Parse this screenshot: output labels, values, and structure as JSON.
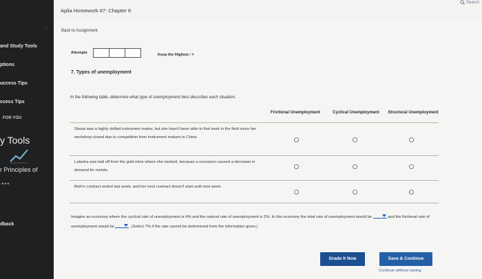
{
  "app": {
    "title": "Aplia Homework #7: Chapter 6",
    "search_label": "Search"
  },
  "sidebar": {
    "items": [
      {
        "label": "and Study Tools"
      },
      {
        "label": "ptions"
      },
      {
        "label": "uccess Tips"
      },
      {
        "label": "ccess Tips"
      },
      {
        "label": "FOR YOU"
      },
      {
        "label": "Tools"
      },
      {
        "label": "r Principles of"
      },
      {
        "label": "•••"
      },
      {
        "label": "dback"
      }
    ]
  },
  "nav": {
    "back_label": "Back to Assignment"
  },
  "attempts": {
    "label": "Attempts",
    "keep_label": "Keep the Highest",
    "keep_value": " / 4"
  },
  "question": {
    "title": "7. Types of unemployment",
    "instruction": "In the following table, determine what type of unemployment best describes each situation.",
    "columns": [
      "Frictional Unemployment",
      "Cyclical Unemployment",
      "Structural Unemployment"
    ],
    "rows": [
      {
        "text": "Stasia was a highly skilled instrument maker, but she hasn't been able to find work in the field since her workshop closed due to competition from instrument makers in China."
      },
      {
        "text": "Latasha was laid off from the gold mine where she worked, because a recession caused a decrease in demand for metals."
      },
      {
        "text": "Beth's contract ended last week, and her next contract doesn't start until next week."
      }
    ],
    "paragraph": {
      "part1": "Imagine an economy where the cyclical rate of unemployment is 4% and the natural rate of unemployment is 2%. In this economy the total rate of unemployment would be",
      "part2": "and the frictional rate of unemployment would be",
      "part3": ". (Select ?% if the rate cannot be determined from the information given.)"
    }
  },
  "actions": {
    "grade_label": "Grade It Now",
    "save_label": "Save & Continue",
    "without_label": "Continue without saving"
  }
}
